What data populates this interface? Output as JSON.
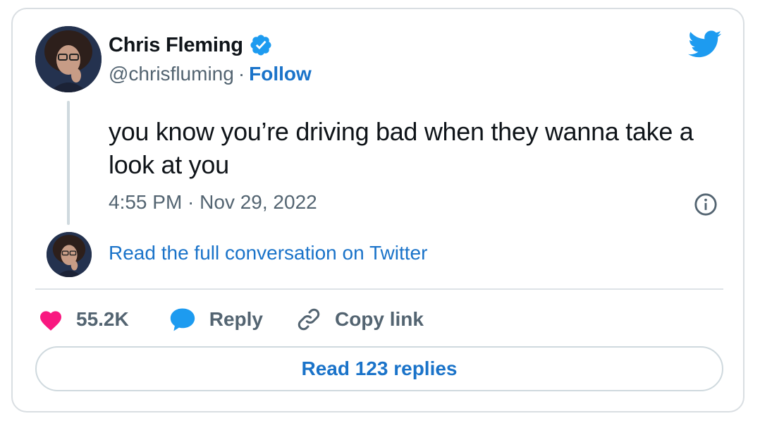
{
  "author": {
    "display_name": "Chris Fleming",
    "handle": "@chrisfluming",
    "separator": "·",
    "follow_label": "Follow",
    "verified": true
  },
  "tweet": {
    "text": "you know you’re driving bad when they wanna take a look at you",
    "timestamp": "4:55 PM · Nov 29, 2022"
  },
  "conversation_link": "Read the full conversation on Twitter",
  "actions": {
    "likes": "55.2K",
    "reply_label": "Reply",
    "copy_link_label": "Copy link"
  },
  "replies_button": "Read 123 replies",
  "colors": {
    "brand_blue": "#1d9bf0",
    "link_blue": "#1a73c9",
    "like_pink": "#f91880",
    "muted_text": "#536471",
    "border": "#cfd9de"
  },
  "icons": [
    "twitter-bird-icon",
    "verified-badge-icon",
    "info-icon",
    "heart-icon",
    "reply-bubble-icon",
    "link-icon"
  ]
}
